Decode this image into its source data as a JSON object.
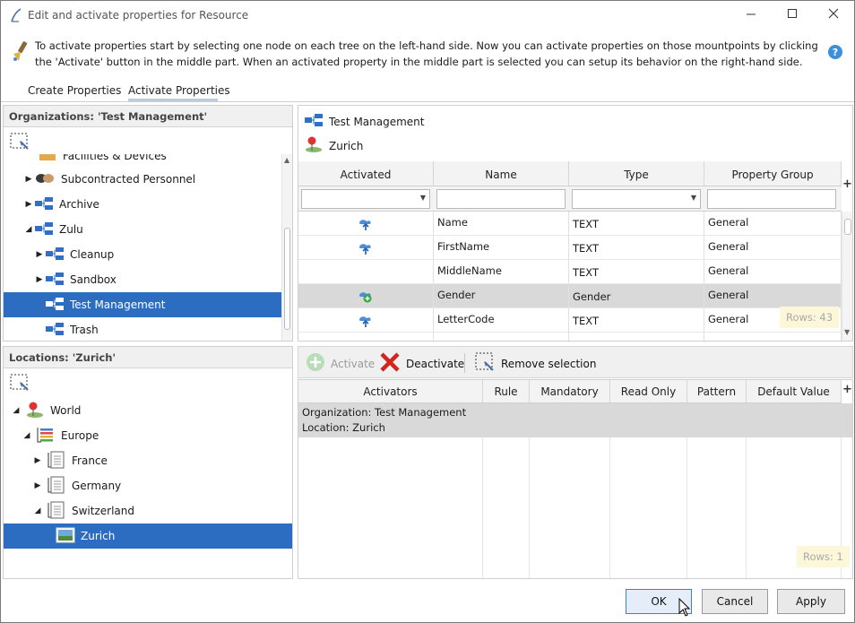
{
  "window": {
    "title": "Edit and activate properties for Resource"
  },
  "info": {
    "text": "To activate properties start by selecting one node on each tree on the left-hand side. Now you can activate properties on those mountpoints by clicking the 'Activate' button in the middle part. When an activated property in the middle part is selected you can setup its behavior on the right-hand side."
  },
  "tabs": [
    {
      "label": "Create Properties"
    },
    {
      "label": "Activate Properties"
    }
  ],
  "org_tree": {
    "title": "Organizations: 'Test Management'",
    "clipped_label": "Facilities & Devices",
    "items": [
      {
        "label": "Subcontracted Personnel",
        "icon": "handshake-icon"
      },
      {
        "label": "Archive",
        "icon": "org-node-icon"
      },
      {
        "label": "Zulu",
        "icon": "org-node-icon"
      },
      {
        "label": "Cleanup",
        "icon": "org-node-icon"
      },
      {
        "label": "Sandbox",
        "icon": "org-node-icon"
      },
      {
        "label": "Test Management",
        "icon": "org-node-icon"
      },
      {
        "label": "Trash",
        "icon": "org-node-icon"
      }
    ]
  },
  "loc_tree": {
    "title": "Locations: 'Zurich'",
    "items": [
      {
        "label": "World",
        "icon": "map-pin-icon"
      },
      {
        "label": "Europe",
        "icon": "region-icon"
      },
      {
        "label": "France",
        "icon": "document-icon"
      },
      {
        "label": "Germany",
        "icon": "document-icon"
      },
      {
        "label": "Switzerland",
        "icon": "document-icon"
      },
      {
        "label": "Zurich",
        "icon": "landscape-icon"
      }
    ]
  },
  "mountpoints": {
    "org": "Test Management",
    "loc": "Zurich"
  },
  "props_grid": {
    "columns": [
      "Activated",
      "Name",
      "Type",
      "Property Group"
    ],
    "rows": [
      {
        "name": "Name",
        "type": "TEXT",
        "group": "General",
        "icon": "property-icon"
      },
      {
        "name": "FirstName",
        "type": "TEXT",
        "group": "General",
        "icon": "property-icon"
      },
      {
        "name": "MiddleName",
        "type": "TEXT",
        "group": "General",
        "icon": ""
      },
      {
        "name": "Gender",
        "type": "Gender",
        "group": "General",
        "icon": "property-add-icon"
      },
      {
        "name": "LetterCode",
        "type": "TEXT",
        "group": "General",
        "icon": "property-icon"
      }
    ],
    "rows_count": "Rows: 43"
  },
  "toolbar": {
    "activate": "Activate",
    "deactivate": "Deactivate",
    "remove": "Remove selection"
  },
  "activators_grid": {
    "columns": [
      "Activators",
      "Rule",
      "Mandatory",
      "Read Only",
      "Pattern",
      "Default Value"
    ],
    "row": {
      "line1": "Organization: Test Management",
      "line2": "Location: Zurich"
    },
    "rows_count": "Rows: 1"
  },
  "buttons": {
    "ok": "OK",
    "cancel": "Cancel",
    "apply": "Apply"
  },
  "colors": {
    "selection": "#2c6dc2",
    "gray_row": "#d9d9d9",
    "rows_badge_bg": "#fbf7d8"
  }
}
